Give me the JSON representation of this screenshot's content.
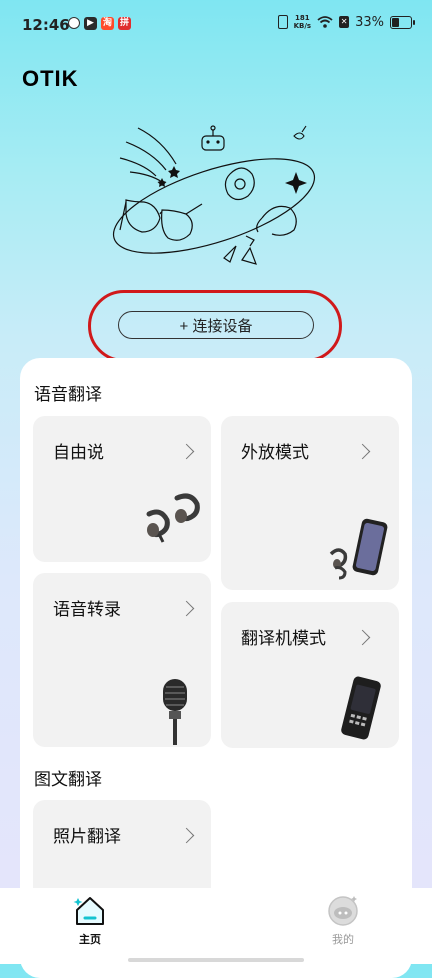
{
  "status_bar": {
    "time": "12:46",
    "net_speed_value": "181",
    "net_speed_unit": "KB/s",
    "battery": "33%",
    "battery_level": 0.33,
    "app_badges": [
      "cloud",
      "play",
      "sale",
      "deal"
    ]
  },
  "brand": "OTIK",
  "connect_button": "+ 连接设备",
  "voice_section": {
    "title": "语音翻译",
    "cards": [
      {
        "label": "自由说",
        "icon": "earbuds-icon"
      },
      {
        "label": "外放模式",
        "icon": "phone-earbuds-icon"
      },
      {
        "label": "语音转录",
        "icon": "microphone-icon"
      },
      {
        "label": "翻译机模式",
        "icon": "translator-device-icon"
      }
    ]
  },
  "image_section": {
    "title": "图文翻译",
    "cards": [
      {
        "label": "照片翻译",
        "icon": "camera-icon"
      }
    ]
  },
  "tabbar": {
    "home": "主页",
    "mine": "我的"
  },
  "colors": {
    "accent": "#14c3d0",
    "highlight_outline": "#d0191b",
    "card_bg": "#f2f2f2"
  }
}
